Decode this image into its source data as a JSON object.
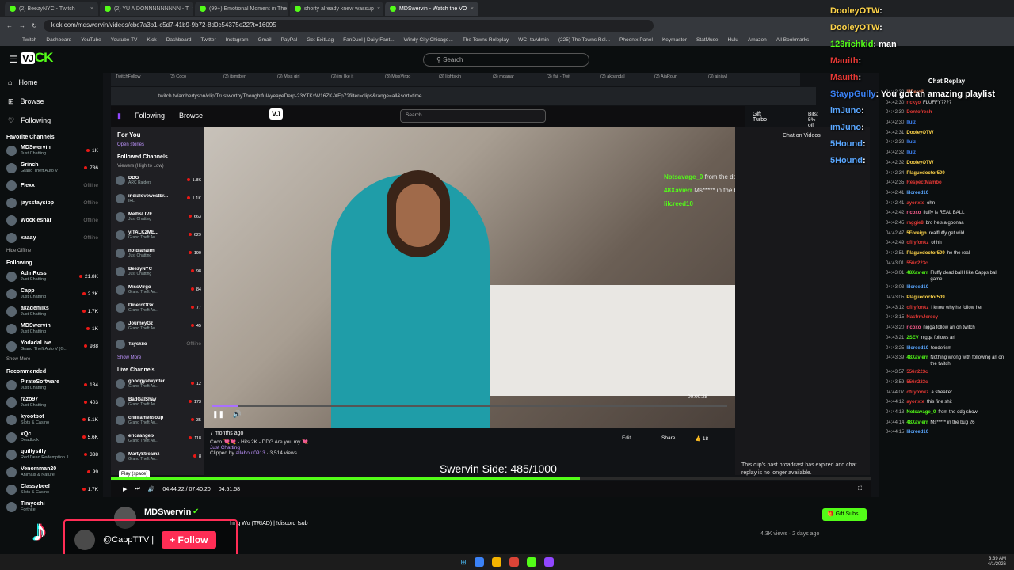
{
  "browser": {
    "tabs": [
      "(2) BeezyNYC - Twitch",
      "(2) YU A DONNNNNNNNN - T",
      "(99+) Emotional Moment in The",
      "shorty already knew wassup",
      "MDSwervin - Watch the VO"
    ],
    "url": "kick.com/mdswervin/videos/cbc7a3b1-c5d7-41b9-9b72-8d0c54375e22?t=16095",
    "bookmarks": [
      "Twitch",
      "Dashboard",
      "YouTube",
      "Youtube TV",
      "Kick",
      "Dashboard",
      "Twitter",
      "Instagram",
      "Gmail",
      "PayPal",
      "Get ExitLag",
      "FanDuel | Daily Fant...",
      "Windy City Chicago...",
      "The Towns Roleplay",
      "WC- taAdmin",
      "(225) The Towns Rol...",
      "Phoenix Panel",
      "Keymaster",
      "StatMuse",
      "Hulu",
      "Amazon",
      "All Bookmarks"
    ]
  },
  "kick": {
    "search_placeholder": "Search",
    "nav": [
      "Home",
      "Browse",
      "Following"
    ],
    "favorite_header": "Favorite Channels",
    "favorites": [
      {
        "name": "MDSwervin",
        "cat": "Just Chatting",
        "v": "1K"
      },
      {
        "name": "Grinch",
        "cat": "Grand Theft Auto V",
        "v": "736"
      },
      {
        "name": "Flexx",
        "cat": "",
        "off": "Offline"
      },
      {
        "name": "jaysstaysipp",
        "cat": "",
        "off": "Offline"
      },
      {
        "name": "Wockiesnar",
        "cat": "",
        "off": "Offline"
      },
      {
        "name": "xaaay",
        "cat": "",
        "off": "Offline"
      }
    ],
    "hide_offline": "Hide Offline",
    "following_header": "Following",
    "following": [
      {
        "name": "AdinRoss",
        "cat": "Just Chatting",
        "v": "21.8K"
      },
      {
        "name": "Capp",
        "cat": "Just Chatting",
        "v": "2.2K"
      },
      {
        "name": "akademiks",
        "cat": "Just Chatting",
        "v": "1.7K"
      },
      {
        "name": "MDSwervin",
        "cat": "Just Chatting",
        "v": "1K"
      },
      {
        "name": "YodadaLive",
        "cat": "Grand Theft Auto V (G...",
        "v": "988"
      }
    ],
    "show_more": "Show More",
    "recommended_header": "Recommended",
    "recommended": [
      {
        "name": "PirateSoftware",
        "cat": "Just Chatting",
        "v": "134"
      },
      {
        "name": "razo97",
        "cat": "Just Chatting",
        "v": "403"
      },
      {
        "name": "kyootbot",
        "cat": "Slots & Casino",
        "v": "5.1K"
      },
      {
        "name": "xQc",
        "cat": "Deadlock",
        "v": "5.6K"
      },
      {
        "name": "quiltysilly",
        "cat": "Red Dead Redemption II",
        "v": "338"
      },
      {
        "name": "Venomman20",
        "cat": "Animals & Nature",
        "v": "99"
      },
      {
        "name": "Classybeef",
        "cat": "Slots & Casino",
        "v": "1.7K"
      },
      {
        "name": "Timyoshi",
        "cat": "Fortnite",
        "v": ""
      }
    ]
  },
  "twitch": {
    "inner_tabs": [
      "TwitchFollow",
      "(3) Coco",
      "(3) itsmtben",
      "(3) Miss girl",
      "(3) im like it",
      "(3) MissVirgo",
      "(3) lightskin",
      "(3) moanar",
      "(3) fail - Twit",
      "(3) akoandal",
      "(3) AjaRoun",
      "(3) ainjayl"
    ],
    "inner_url": "twitch.tv/ambertyson/clip/TrustworthyThoughtfulAyeayeDerp-23YTKxW16ZK-XFp7?filter=clips&range=all&sort=time",
    "following": "Following",
    "browse": "Browse",
    "search": "Search",
    "gift_turbo": "Gift Turbo",
    "bits": "Bits: 5% off",
    "for_you": "For You",
    "open_stories": "Open stories",
    "followed_channels": "Followed Channels",
    "viewers_sort": "Viewers (High to Low)",
    "channels": [
      {
        "name": "DDG",
        "cat": "ARC Raiders",
        "v": "1.8K"
      },
      {
        "name": "indialovewestbr...",
        "cat": "IRL",
        "v": "1.1K"
      },
      {
        "name": "MeltisLIVE",
        "cat": "Just Chatting",
        "v": "663"
      },
      {
        "name": "yiTALK2ME...",
        "cat": "Grand Theft Au...",
        "v": "629"
      },
      {
        "name": "notdianalim",
        "cat": "Just Chatting",
        "v": "190"
      },
      {
        "name": "BeezyNYC",
        "cat": "Just Chatting",
        "v": "98"
      },
      {
        "name": "MissVirgo",
        "cat": "Grand Theft Au...",
        "v": "84"
      },
      {
        "name": "DineroOGx",
        "cat": "Grand Theft Au...",
        "v": "77"
      },
      {
        "name": "JourneyGz",
        "cat": "Grand Theft Au...",
        "v": "45"
      },
      {
        "name": "Tayskiio",
        "cat": "",
        "off": "Offline"
      }
    ],
    "show_more": "Show More",
    "live_channels": "Live Channels",
    "live": [
      {
        "name": "goodgyalwynter",
        "cat": "Grand Theft Au...",
        "v": "12"
      },
      {
        "name": "BadGalShay",
        "cat": "Grand Theft Au...",
        "v": "173"
      },
      {
        "name": "chiliramensoup",
        "cat": "Grand Theft Au...",
        "v": "35"
      },
      {
        "name": "ericaangelx",
        "cat": "Grand Theft Au...",
        "v": "118"
      },
      {
        "name": "MartyStreamz",
        "cat": "Grand Theft Au...",
        "v": "8"
      }
    ],
    "chat_on_videos": "Chat on Videos",
    "video_chat": [
      {
        "u": "Notsavage_0",
        "t": "from the ddg show"
      },
      {
        "u": "48Xavierr",
        "t": "Ms***** in the bug 26"
      },
      {
        "u": "lilcreed10",
        "t": ""
      }
    ],
    "timestamp": "00:00:28",
    "clip_age": "7 months ago",
    "clip_title": "Coco 💘💘 - Hits 2K - DDG Are you my 💘",
    "clip_cat": "Just Chatting",
    "clipped_by": "Clipped by",
    "clipper": "allabout0913",
    "clip_views": "3,514 views",
    "edit": "Edit",
    "share": "Share",
    "likes": "18",
    "expired": "This clip's past broadcast has expired and chat replay is no longer available."
  },
  "overlay_text": "Swervin Side: 485/1000",
  "player": {
    "tooltip": "Play (space)",
    "time": "04:44:22 / 07:40:20",
    "remaining": "04:51:58",
    "progress": 0.617
  },
  "channel": {
    "name": "MDSwervin",
    "title": "hing Wo (TRIAD) | !discord !sub",
    "gift_subs": "Gift Subs",
    "views": "4.3K views",
    "ago": "2 days ago"
  },
  "tiktok": {
    "handle": "@CappTTV |",
    "follow": "+ Follow"
  },
  "overlay_chat": [
    {
      "u": "DooleyOTW",
      "t": ":",
      "c": "#ffd54a"
    },
    {
      "u": "DooleyOTW",
      "t": ":",
      "c": "#ffd54a"
    },
    {
      "u": "123richkid",
      "t": ": man",
      "c": "#53fc18"
    },
    {
      "u": "Mauith",
      "t": ":",
      "c": "#e53935"
    },
    {
      "u": "Mauith",
      "t": ":",
      "c": "#e53935"
    },
    {
      "u": "StaypGully",
      "t": ": You got an amazing playlist",
      "c": "#3b82f6"
    },
    {
      "u": "imJuno",
      "t": ":",
      "c": "#5aa7ff"
    },
    {
      "u": "imJuno",
      "t": ":",
      "c": "#5aa7ff"
    },
    {
      "u": "5Hound",
      "t": ":",
      "c": "#5aa7ff"
    },
    {
      "u": "5Hound",
      "t": ":",
      "c": "#5aa7ff"
    }
  ],
  "chat_replay": {
    "title": "Chat Replay",
    "messages": [
      {
        "tm": "04:42:30",
        "u": "lilPercil",
        "t": "",
        "c": "#ff8a65"
      },
      {
        "tm": "04:42:30",
        "u": "rickyo",
        "t": "FLUFFY????",
        "c": "#e53935"
      },
      {
        "tm": "04:42:30",
        "u": "Dontofresh",
        "t": "",
        "c": "#e53935"
      },
      {
        "tm": "04:42:30",
        "u": "lluiz",
        "t": "",
        "c": "#3b82f6"
      },
      {
        "tm": "04:42:31",
        "u": "DooleyOTW",
        "t": "",
        "c": "#ffd54a"
      },
      {
        "tm": "04:42:32",
        "u": "lluiz",
        "t": "",
        "c": "#3b82f6"
      },
      {
        "tm": "04:42:32",
        "u": "lluiz",
        "t": "",
        "c": "#3b82f6"
      },
      {
        "tm": "04:42:32",
        "u": "DooleyOTW",
        "t": "",
        "c": "#ffd54a"
      },
      {
        "tm": "04:42:34",
        "u": "Plaguedoctor509",
        "t": "",
        "c": "#ffd54a"
      },
      {
        "tm": "04:42:35",
        "u": "RespectMambo",
        "t": "",
        "c": "#e53935"
      },
      {
        "tm": "04:42:41",
        "u": "lilcreed10",
        "t": "",
        "c": "#5aa7ff"
      },
      {
        "tm": "04:42:41",
        "u": "ayonxte",
        "t": "ohn",
        "c": "#e53935"
      },
      {
        "tm": "04:42:42",
        "u": "ricoxo",
        "t": "fluffy is REAL BALL",
        "c": "#ff6090"
      },
      {
        "tm": "04:42:45",
        "u": "raggie8",
        "t": "bro he's a goonaa",
        "c": "#e53935"
      },
      {
        "tm": "04:42:47",
        "u": "5Foreign",
        "t": "realfluffy get wild",
        "c": "#ffd54a"
      },
      {
        "tm": "04:42:49",
        "u": "ofilyfonkz",
        "t": "ohhh",
        "c": "#e53935"
      },
      {
        "tm": "04:42:51",
        "u": "Plaguedoctor509",
        "t": "he the real",
        "c": "#ffd54a"
      },
      {
        "tm": "04:43:01",
        "u": "556n223c",
        "t": "",
        "c": "#e53935"
      },
      {
        "tm": "04:43:01",
        "u": "48Xavierr",
        "t": "Fluffy dead ball I like Capps ball game",
        "c": "#53fc18"
      },
      {
        "tm": "04:43:03",
        "u": "lilcreed10",
        "t": "",
        "c": "#5aa7ff"
      },
      {
        "tm": "04:43:05",
        "u": "Plaguedoctor509",
        "t": "",
        "c": "#ffd54a"
      },
      {
        "tm": "04:43:12",
        "u": "ofilyfonkz",
        "t": "i know why he follow her",
        "c": "#e53935"
      },
      {
        "tm": "04:43:15",
        "u": "NasfrmJersey",
        "t": "",
        "c": "#e53935"
      },
      {
        "tm": "04:43:20",
        "u": "ricoxo",
        "t": "nigga follow ari on twitch",
        "c": "#ff6090"
      },
      {
        "tm": "04:43:21",
        "u": "2SEV",
        "t": "nigga follows ari",
        "c": "#53fc18"
      },
      {
        "tm": "04:43:25",
        "u": "lilcreed10",
        "t": "tenderism",
        "c": "#5aa7ff"
      },
      {
        "tm": "04:43:39",
        "u": "48Xavierr",
        "t": "Nothing wrong with following ari on the twitch",
        "c": "#53fc18"
      },
      {
        "tm": "04:43:57",
        "u": "556n223c",
        "t": "",
        "c": "#e53935"
      },
      {
        "tm": "04:43:59",
        "u": "556n223c",
        "t": "",
        "c": "#e53935"
      },
      {
        "tm": "04:44:07",
        "u": "ofilyfonkz",
        "t": "a streaker",
        "c": "#e53935"
      },
      {
        "tm": "04:44:12",
        "u": "ayonxte",
        "t": "this fine shit",
        "c": "#e53935"
      },
      {
        "tm": "04:44:13",
        "u": "Notsavage_0",
        "t": "from the ddg show",
        "c": "#53fc18"
      },
      {
        "tm": "04:44:14",
        "u": "48Xavierr",
        "t": "Ms***** in the bug 26",
        "c": "#53fc18"
      },
      {
        "tm": "04:44:15",
        "u": "lilcreed10",
        "t": "",
        "c": "#5aa7ff"
      }
    ]
  },
  "clock": {
    "time": "3:39 AM",
    "date": "4/1/2026"
  }
}
